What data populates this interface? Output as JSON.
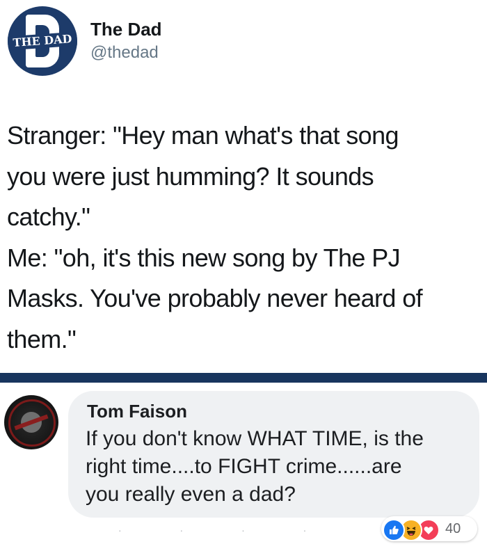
{
  "tweet": {
    "avatar_text": "THE DAD",
    "display_name": "The Dad",
    "handle": "@thedad",
    "lines": [
      "Stranger: \"Hey man what's that song",
      "you were just humming? It sounds",
      "catchy.\"",
      "Me: \"oh, it's this new song by The PJ",
      "Masks. You've probably never heard of",
      "them.\""
    ]
  },
  "comment": {
    "author": "Tom Faison",
    "lines": [
      "If you don't know WHAT TIME, is the",
      "right time....to FIGHT crime......are",
      "you really even a dad?"
    ],
    "reactions": {
      "icons": [
        "like-icon",
        "haha-icon",
        "love-icon"
      ],
      "count": "40"
    }
  },
  "colors": {
    "divider": "#18355e",
    "avatar_bg": "#1d3b6a",
    "bubble_bg": "#eff1f3",
    "like": "#1877f2",
    "haha": "#f7b125",
    "love": "#f33e58"
  }
}
